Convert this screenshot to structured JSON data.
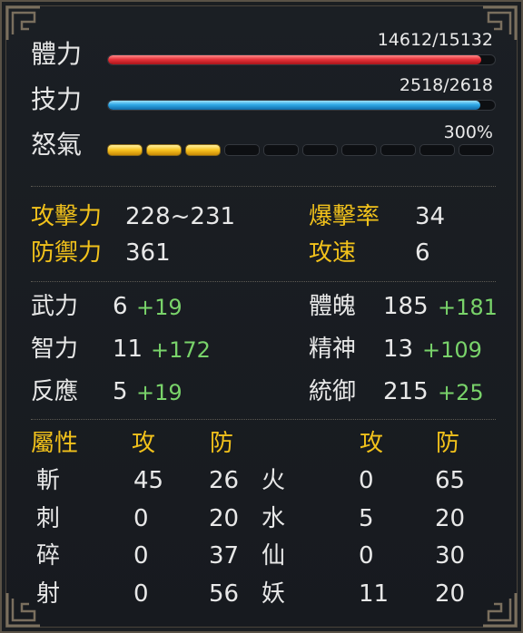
{
  "bars": {
    "hp": {
      "label": "體力",
      "value": "14612/15132",
      "current": 14612,
      "max": 15132
    },
    "mp": {
      "label": "技力",
      "value": "2518/2618",
      "current": 2518,
      "max": 2618
    },
    "rage": {
      "label": "怒氣",
      "value": "300%",
      "segments_filled": 3,
      "segments_total": 10
    }
  },
  "combat": {
    "attack_label": "攻擊力",
    "attack_value": "228~231",
    "crit_label": "爆擊率",
    "crit_value": "34",
    "defense_label": "防禦力",
    "defense_value": "361",
    "speed_label": "攻速",
    "speed_value": "6"
  },
  "attributes": {
    "str_label": "武力",
    "str_base": "6",
    "str_bonus": "+19",
    "con_label": "體魄",
    "con_base": "185",
    "con_bonus": "+181",
    "int_label": "智力",
    "int_base": "11",
    "int_bonus": "+172",
    "spi_label": "精神",
    "spi_base": "13",
    "spi_bonus": "+109",
    "agi_label": "反應",
    "agi_base": "5",
    "agi_bonus": "+19",
    "lea_label": "統御",
    "lea_base": "215",
    "lea_bonus": "+25"
  },
  "elements": {
    "header": {
      "title": "屬性",
      "atk1": "攻",
      "def1": "防",
      "atk2": "攻",
      "def2": "防"
    },
    "rows": [
      {
        "left_name": "斬",
        "left_atk": "45",
        "left_def": "26",
        "right_name": "火",
        "right_atk": "0",
        "right_def": "65"
      },
      {
        "left_name": "刺",
        "left_atk": "0",
        "left_def": "20",
        "right_name": "水",
        "right_atk": "5",
        "right_def": "20"
      },
      {
        "left_name": "碎",
        "left_atk": "0",
        "left_def": "37",
        "right_name": "仙",
        "right_atk": "0",
        "right_def": "30"
      },
      {
        "left_name": "射",
        "left_atk": "0",
        "left_def": "56",
        "right_name": "妖",
        "right_atk": "11",
        "right_def": "20"
      }
    ]
  },
  "colors": {
    "gold": "#f2c21b",
    "bonus_green": "#79d36a",
    "hp_red": "#e8333a",
    "mp_blue": "#2fa8e6",
    "rage_yellow": "#f8c21f"
  }
}
